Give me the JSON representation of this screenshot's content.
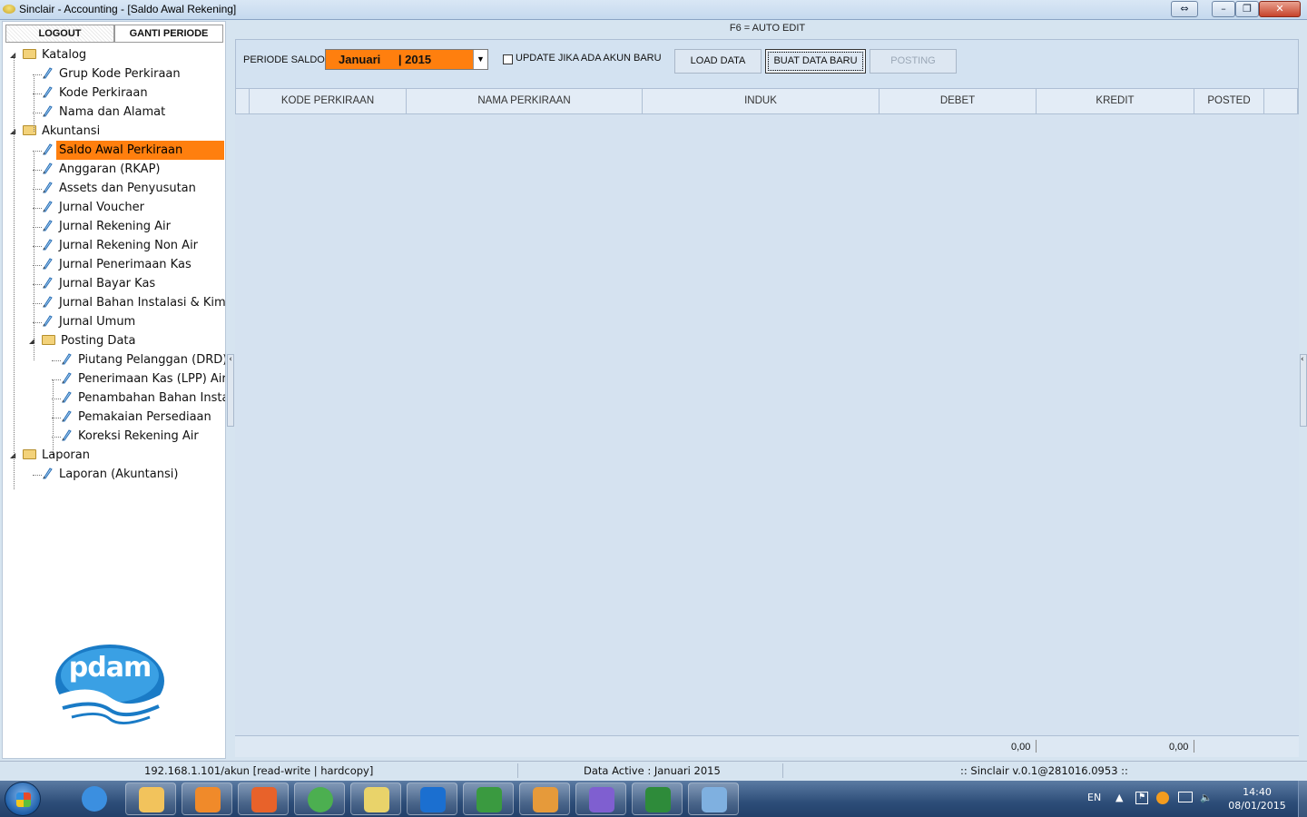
{
  "window": {
    "title": "Sinclair - Accounting - [Saldo Awal Rekening]",
    "controls": {
      "restore": "⇔",
      "minimize": "–",
      "maximize": "❐",
      "close": "✕"
    }
  },
  "left": {
    "logout": "LOGOUT",
    "ganti_periode": "GANTI PERIODE",
    "tree": [
      {
        "label": "Katalog",
        "type": "folder",
        "level": 0,
        "expanded": true
      },
      {
        "label": "Grup Kode Perkiraan",
        "type": "leaf",
        "level": 1
      },
      {
        "label": "Kode Perkiraan",
        "type": "leaf",
        "level": 1
      },
      {
        "label": "Nama dan Alamat",
        "type": "leaf",
        "level": 1
      },
      {
        "label": "Akuntansi",
        "type": "folder",
        "level": 0,
        "expanded": true
      },
      {
        "label": "Saldo Awal Perkiraan",
        "type": "leaf",
        "level": 1,
        "selected": true
      },
      {
        "label": "Anggaran (RKAP)",
        "type": "leaf",
        "level": 1
      },
      {
        "label": "Assets dan Penyusutan",
        "type": "leaf",
        "level": 1
      },
      {
        "label": "Jurnal Voucher",
        "type": "leaf",
        "level": 1
      },
      {
        "label": "Jurnal Rekening Air",
        "type": "leaf",
        "level": 1
      },
      {
        "label": "Jurnal Rekening Non Air",
        "type": "leaf",
        "level": 1
      },
      {
        "label": "Jurnal Penerimaan Kas",
        "type": "leaf",
        "level": 1
      },
      {
        "label": "Jurnal Bayar Kas",
        "type": "leaf",
        "level": 1
      },
      {
        "label": "Jurnal Bahan Instalasi & Kim",
        "type": "leaf",
        "level": 1
      },
      {
        "label": "Jurnal Umum",
        "type": "leaf",
        "level": 1
      },
      {
        "label": "Posting Data",
        "type": "folder",
        "level": 1,
        "expanded": true
      },
      {
        "label": "Piutang Pelanggan (DRD)",
        "type": "leaf",
        "level": 2
      },
      {
        "label": "Penerimaan Kas (LPP) Air",
        "type": "leaf",
        "level": 2
      },
      {
        "label": "Penambahan Bahan Insta",
        "type": "leaf",
        "level": 2
      },
      {
        "label": "Pemakaian Persediaan",
        "type": "leaf",
        "level": 2
      },
      {
        "label": "Koreksi Rekening Air",
        "type": "leaf",
        "level": 2
      },
      {
        "label": "Laporan",
        "type": "folder",
        "level": 0,
        "expanded": true
      },
      {
        "label": "Laporan (Akuntansi)",
        "type": "leaf",
        "level": 1
      }
    ],
    "logo_text": "pdam"
  },
  "main": {
    "hint": "F6 = AUTO EDIT",
    "periode_label": "PERIODE SALDO",
    "periode_month": "Januari",
    "periode_year": "| 2015",
    "update_checkbox_label": "UPDATE JIKA ADA AKUN BARU",
    "update_checked": false,
    "load_data": "LOAD DATA",
    "buat_data_baru": "BUAT DATA BARU",
    "posting": "POSTING",
    "columns": [
      "",
      "KODE PERKIRAAN",
      "NAMA PERKIRAAN",
      "INDUK",
      "DEBET",
      "KREDIT",
      "POSTED",
      ""
    ],
    "rows": [],
    "footer_debet": "0,00",
    "footer_kredit": "0,00"
  },
  "status": {
    "connection": "192.168.1.101/akun [read-write | hardcopy]",
    "data_active": "Data Active : Januari 2015",
    "version": ":: Sinclair v.0.1@281016.0953 ::"
  },
  "taskbar": {
    "apps": [
      "internet-explorer",
      "file-explorer",
      "media-player",
      "firefox",
      "chrome",
      "sinclair-accounting",
      "teamviewer",
      "video-editor",
      "tag-tool",
      "app-grid",
      "excel",
      "paint"
    ],
    "language": "EN",
    "time": "14:40",
    "date": "08/01/2015"
  }
}
